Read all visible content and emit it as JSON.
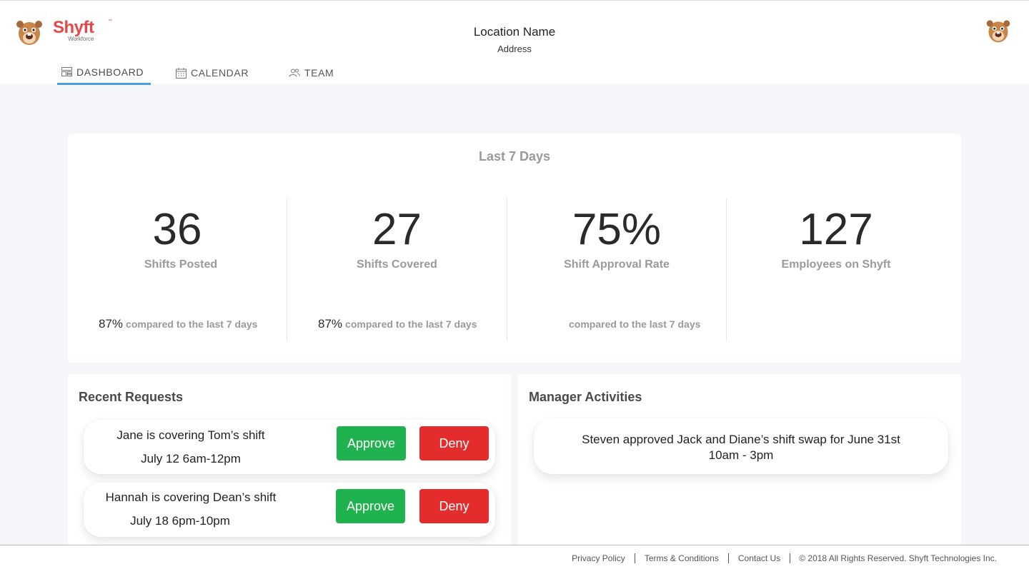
{
  "header": {
    "brand": "Shyft",
    "brand_tm": "™",
    "brand_sub": "Workforce",
    "location_name": "Location Name",
    "location_address": "Address"
  },
  "nav": {
    "dashboard": "DASHBOARD",
    "calendar": "CALENDAR",
    "team": "TEAM"
  },
  "stats": {
    "title": "Last 7 Days",
    "items": [
      {
        "value": "36",
        "label": "Shifts Posted",
        "compare_pct": "87%",
        "compare_text": "compared to the last 7 days"
      },
      {
        "value": "27",
        "label": "Shifts Covered",
        "compare_pct": "87%",
        "compare_text": "compared to the last 7 days"
      },
      {
        "value": "75%",
        "label": "Shift Approval Rate",
        "compare_pct": "",
        "compare_text": "compared to the last 7 days"
      },
      {
        "value": "127",
        "label": "Employees on Shyft"
      }
    ]
  },
  "requests": {
    "title": "Recent Requests",
    "items": [
      {
        "line1": "Jane is covering Tom’s shift",
        "line2": "July 12 6am-12pm",
        "approve": "Approve",
        "deny": "Deny"
      },
      {
        "line1": "Hannah is covering Dean’s shift",
        "line2": "July 18 6pm-10pm",
        "approve": "Approve",
        "deny": "Deny"
      }
    ]
  },
  "activities": {
    "title": "Manager Activities",
    "items": [
      {
        "line1": "Steven approved Jack and Diane’s shift swap for June 31st",
        "line2": "10am - 3pm"
      }
    ]
  },
  "footer": {
    "privacy": "Privacy Policy",
    "terms": "Terms & Conditions",
    "contact": "Contact Us",
    "copyright": "© 2018 All Rights Reserved. Shyft Technologies Inc."
  },
  "colors": {
    "brand": "#e8474a",
    "nav_active": "#4b9ee0",
    "approve": "#20b24f",
    "deny": "#e42c2d"
  }
}
